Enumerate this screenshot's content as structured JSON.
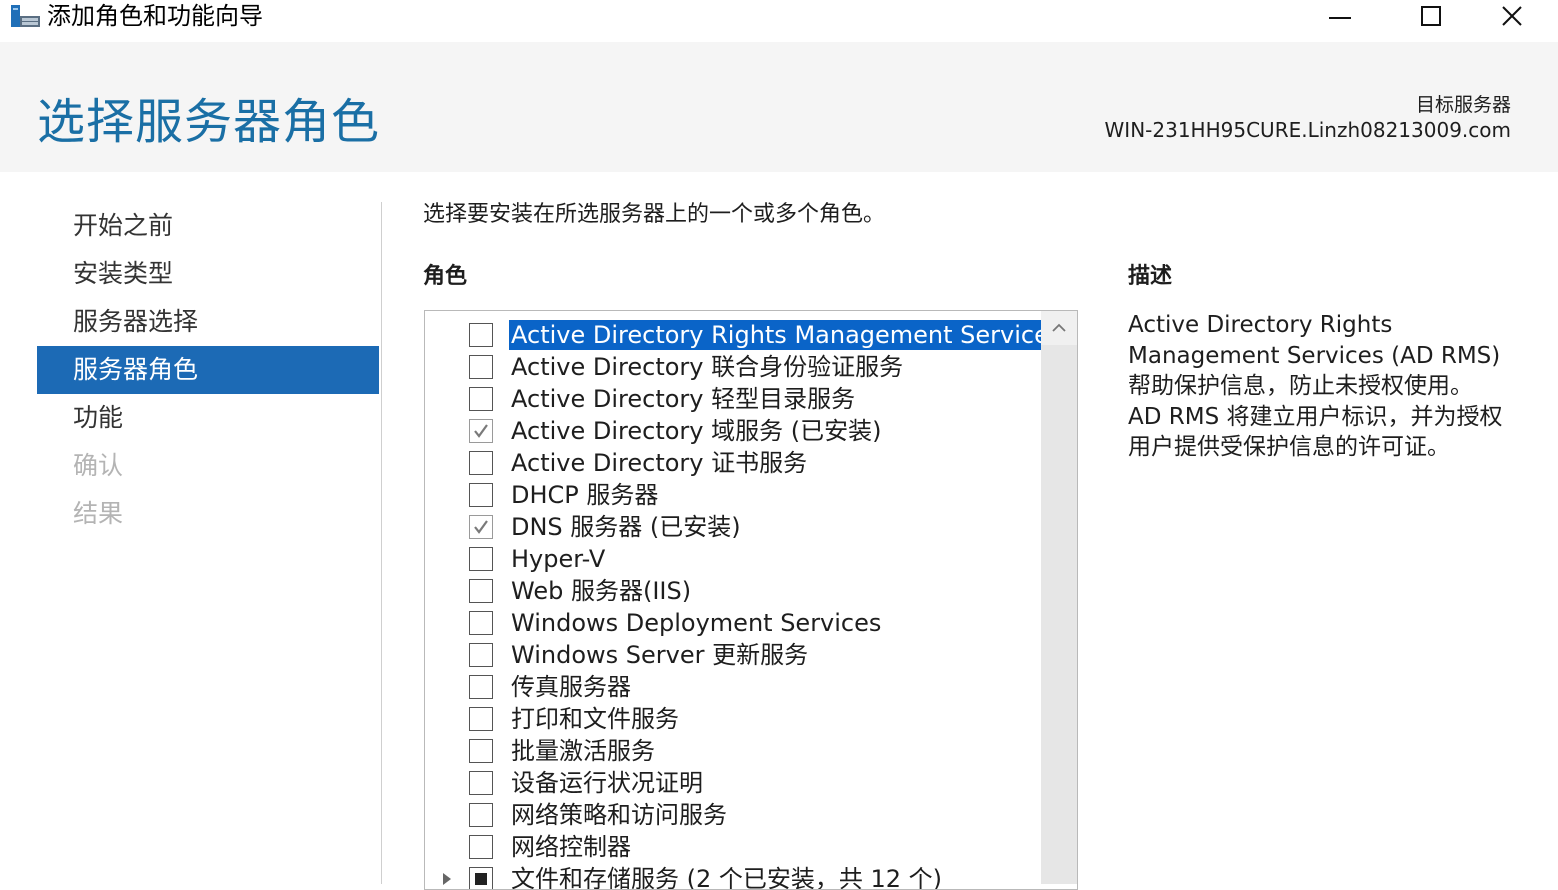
{
  "window": {
    "title": "添加角色和功能向导",
    "controls": {
      "minimize_icon": "minimize-icon",
      "maximize_icon": "maximize-icon",
      "close_icon": "close-icon"
    }
  },
  "header": {
    "page_title": "选择服务器角色",
    "destination_label": "目标服务器",
    "destination_server": "WIN-231HH95CURE.Linzh08213009.com"
  },
  "nav": {
    "items": [
      {
        "label": "开始之前",
        "state": "normal"
      },
      {
        "label": "安装类型",
        "state": "normal"
      },
      {
        "label": "服务器选择",
        "state": "normal"
      },
      {
        "label": "服务器角色",
        "state": "active"
      },
      {
        "label": "功能",
        "state": "normal"
      },
      {
        "label": "确认",
        "state": "disabled"
      },
      {
        "label": "结果",
        "state": "disabled"
      }
    ]
  },
  "main": {
    "instruction": "选择要安装在所选服务器上的一个或多个角色。",
    "roles_heading": "角色",
    "roles": [
      {
        "label": "Active Directory Rights Management Services",
        "check": "none",
        "selected": true
      },
      {
        "label": "Active Directory 联合身份验证服务",
        "check": "none"
      },
      {
        "label": "Active Directory 轻型目录服务",
        "check": "none"
      },
      {
        "label": "Active Directory 域服务 (已安装)",
        "check": "checked-disabled"
      },
      {
        "label": "Active Directory 证书服务",
        "check": "none"
      },
      {
        "label": "DHCP 服务器",
        "check": "none"
      },
      {
        "label": "DNS 服务器 (已安装)",
        "check": "checked-disabled"
      },
      {
        "label": "Hyper-V",
        "check": "none"
      },
      {
        "label": "Web 服务器(IIS)",
        "check": "none"
      },
      {
        "label": "Windows Deployment Services",
        "check": "none"
      },
      {
        "label": "Windows Server 更新服务",
        "check": "none"
      },
      {
        "label": "传真服务器",
        "check": "none"
      },
      {
        "label": "打印和文件服务",
        "check": "none"
      },
      {
        "label": "批量激活服务",
        "check": "none"
      },
      {
        "label": "设备运行状况证明",
        "check": "none"
      },
      {
        "label": "网络策略和访问服务",
        "check": "none"
      },
      {
        "label": "网络控制器",
        "check": "none"
      },
      {
        "label": "文件和存储服务 (2 个已安装，共 12 个)",
        "check": "indeterminate",
        "expandable": true
      }
    ],
    "description_heading": "描述",
    "description_lines": [
      "Active Directory Rights",
      "Management Services (AD RMS)",
      "帮助保护信息，防止未授权使用。",
      "AD RMS 将建立用户标识，并为授权",
      "用户提供受保护信息的许可证。"
    ]
  },
  "colors": {
    "title_blue": "#1a6fa5",
    "nav_active": "#1c6ab5",
    "selection": "#0a64c8",
    "disabled_text": "#b4b4b4"
  }
}
